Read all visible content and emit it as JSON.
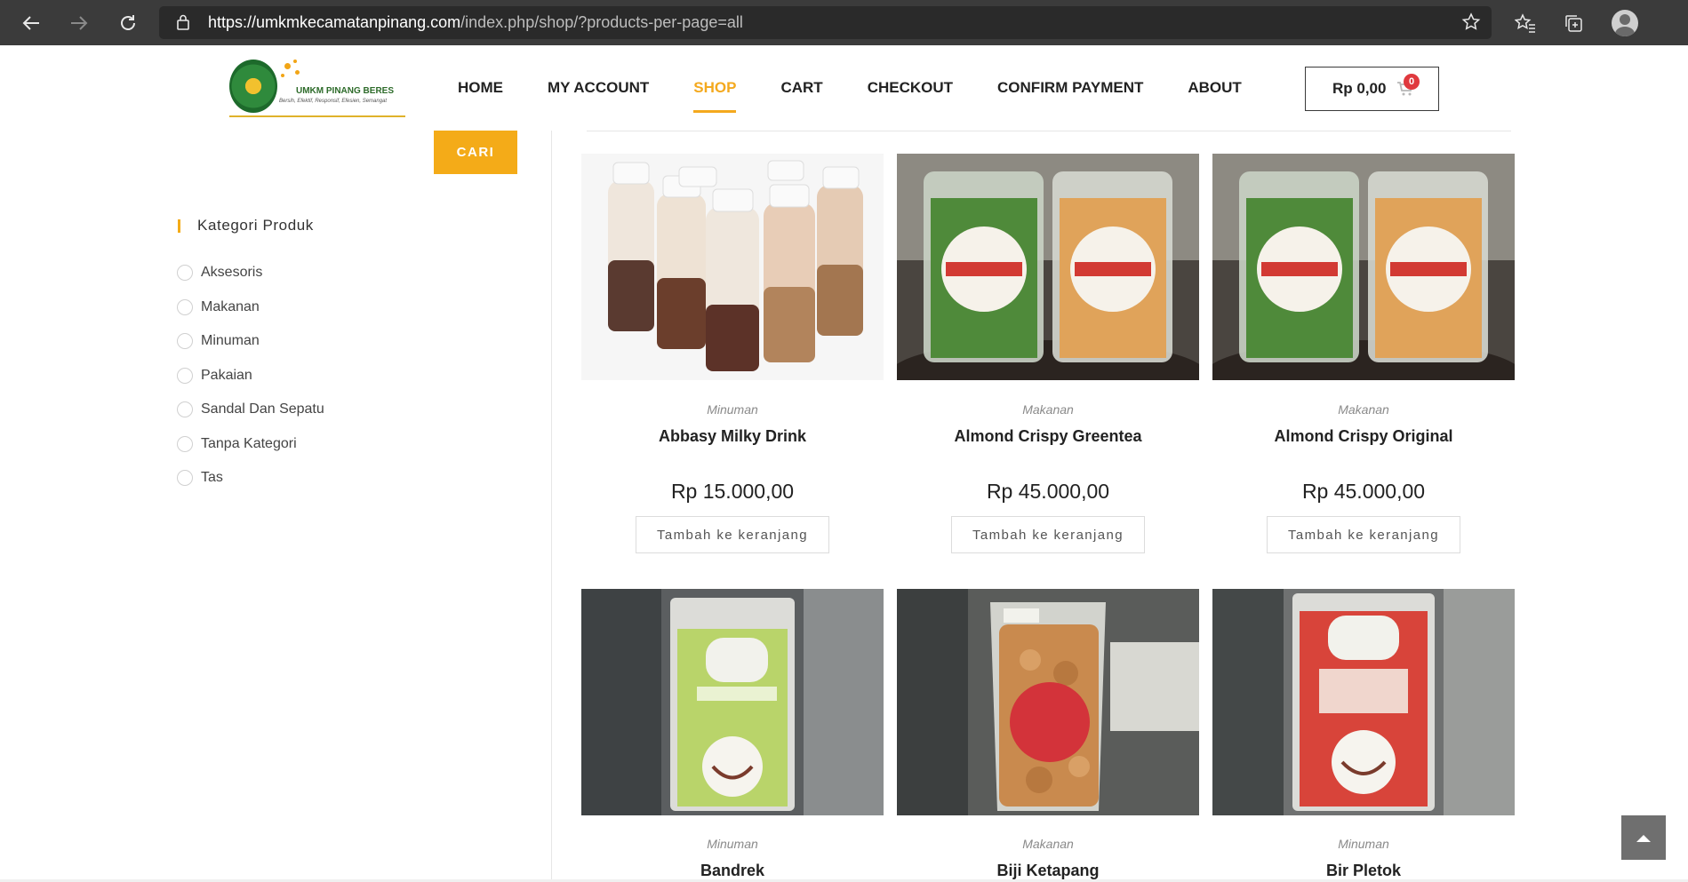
{
  "browser": {
    "url_host": "https://umkmkecamatanpinang.com",
    "url_path": "/index.php/shop/?products-per-page=all"
  },
  "logo": {
    "title": "UMKM PINANG BERES",
    "subtitle": "Bersih, Efektif, Responsif, Efesien, Semangat"
  },
  "nav": {
    "items": [
      {
        "label": "HOME",
        "active": false
      },
      {
        "label": "MY ACCOUNT",
        "active": false
      },
      {
        "label": "SHOP",
        "active": true
      },
      {
        "label": "CART",
        "active": false
      },
      {
        "label": "CHECKOUT",
        "active": false
      },
      {
        "label": "CONFIRM PAYMENT",
        "active": false
      },
      {
        "label": "ABOUT",
        "active": false
      }
    ],
    "cart_total": "Rp 0,00",
    "cart_count": "0"
  },
  "sidebar": {
    "search_label": "CARI",
    "category_title": "Kategori Produk",
    "categories": [
      "Aksesoris",
      "Makanan",
      "Minuman",
      "Pakaian",
      "Sandal Dan Sepatu",
      "Tanpa Kategori",
      "Tas"
    ]
  },
  "products": [
    {
      "category": "Minuman",
      "name": "Abbasy Milky Drink",
      "price": "Rp 15.000,00",
      "button": "Tambah ke keranjang"
    },
    {
      "category": "Makanan",
      "name": "Almond Crispy Greentea",
      "price": "Rp 45.000,00",
      "button": "Tambah ke keranjang"
    },
    {
      "category": "Makanan",
      "name": "Almond Crispy Original",
      "price": "Rp 45.000,00",
      "button": "Tambah ke keranjang"
    },
    {
      "category": "Minuman",
      "name": "Bandrek"
    },
    {
      "category": "Makanan",
      "name": "Biji Ketapang"
    },
    {
      "category": "Minuman",
      "name": "Bir Pletok"
    }
  ],
  "colors": {
    "accent": "#f4ab18",
    "browser_bar": "#3b3b3b",
    "badge": "#e0393e"
  }
}
